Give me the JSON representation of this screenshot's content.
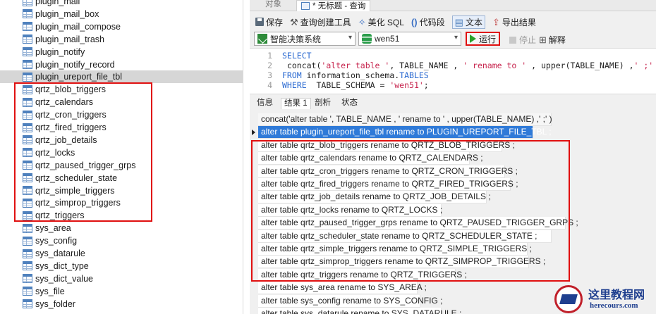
{
  "tree": {
    "items": [
      {
        "label": "plugin_mail"
      },
      {
        "label": "plugin_mail_box"
      },
      {
        "label": "plugin_mail_compose"
      },
      {
        "label": "plugin_mail_trash"
      },
      {
        "label": "plugin_notify"
      },
      {
        "label": "plugin_notify_record"
      },
      {
        "label": "plugin_ureport_file_tbl",
        "selected": true
      },
      {
        "label": "qrtz_blob_triggers"
      },
      {
        "label": "qrtz_calendars"
      },
      {
        "label": "qrtz_cron_triggers"
      },
      {
        "label": "qrtz_fired_triggers"
      },
      {
        "label": "qrtz_job_details"
      },
      {
        "label": "qrtz_locks"
      },
      {
        "label": "qrtz_paused_trigger_grps"
      },
      {
        "label": "qrtz_scheduler_state"
      },
      {
        "label": "qrtz_simple_triggers"
      },
      {
        "label": "qrtz_simprop_triggers"
      },
      {
        "label": "qrtz_triggers"
      },
      {
        "label": "sys_area"
      },
      {
        "label": "sys_config"
      },
      {
        "label": "sys_datarule"
      },
      {
        "label": "sys_dict_type"
      },
      {
        "label": "sys_dict_value"
      },
      {
        "label": "sys_file"
      },
      {
        "label": "sys_folder"
      }
    ]
  },
  "tabs": {
    "objects": "对象",
    "query": "* 无标题 - 查询"
  },
  "toolbar": {
    "save": "保存",
    "query_builder": "查询创建工具",
    "beautify": "美化 SQL",
    "snippet": "代码段",
    "text": "文本",
    "export": "导出结果"
  },
  "runbar": {
    "connection": "智能决策系统",
    "database": "wen51",
    "run": "运行",
    "stop": "停止",
    "explain": "解释"
  },
  "editor": {
    "lines": [
      {
        "num": "1",
        "parts": [
          {
            "t": "SELECT",
            "c": "kw"
          }
        ]
      },
      {
        "num": "2",
        "parts": [
          {
            "t": " concat(",
            "c": ""
          },
          {
            "t": "'alter table '",
            "c": "str"
          },
          {
            "t": ", TABLE_NAME , ",
            "c": ""
          },
          {
            "t": "' rename to '",
            "c": "str"
          },
          {
            "t": " , upper(TABLE_NAME) ,",
            "c": ""
          },
          {
            "t": "' ;'",
            "c": "str"
          },
          {
            "t": " )",
            "c": ""
          }
        ]
      },
      {
        "num": "3",
        "parts": [
          {
            "t": "FROM",
            "c": "kw"
          },
          {
            "t": " information_schema.",
            "c": ""
          },
          {
            "t": "TABLES",
            "c": "kw"
          }
        ]
      },
      {
        "num": "4",
        "parts": [
          {
            "t": "WHERE",
            "c": "kw"
          },
          {
            "t": "  TABLE_SCHEMA = ",
            "c": ""
          },
          {
            "t": "'wen51'",
            "c": "str"
          },
          {
            "t": ";",
            "c": ""
          }
        ]
      }
    ]
  },
  "result_tabs": {
    "info": "信息",
    "result1": "结果 1",
    "profile": "剖析",
    "status": "状态"
  },
  "grid": {
    "header": "concat('alter table ', TABLE_NAME , ' rename to ' , upper(TABLE_NAME) ,' ;' )",
    "rows": [
      {
        "text": "alter table plugin_ureport_file_tbl rename to PLUGIN_UREPORT_FILE_TBL ;",
        "selected": true
      },
      {
        "text": "alter table qrtz_blob_triggers rename to QRTZ_BLOB_TRIGGERS ;"
      },
      {
        "text": "alter table qrtz_calendars rename to QRTZ_CALENDARS ;"
      },
      {
        "text": "alter table qrtz_cron_triggers rename to QRTZ_CRON_TRIGGERS ;"
      },
      {
        "text": "alter table qrtz_fired_triggers rename to QRTZ_FIRED_TRIGGERS ;"
      },
      {
        "text": "alter table qrtz_job_details rename to QRTZ_JOB_DETAILS ;"
      },
      {
        "text": "alter table qrtz_locks rename to QRTZ_LOCKS ;"
      },
      {
        "text": "alter table qrtz_paused_trigger_grps rename to QRTZ_PAUSED_TRIGGER_GRPS ;"
      },
      {
        "text": "alter table qrtz_scheduler_state rename to QRTZ_SCHEDULER_STATE ;"
      },
      {
        "text": "alter table qrtz_simple_triggers rename to QRTZ_SIMPLE_TRIGGERS ;"
      },
      {
        "text": "alter table qrtz_simprop_triggers rename to QRTZ_SIMPROP_TRIGGERS ;"
      },
      {
        "text": "alter table qrtz_triggers rename to QRTZ_TRIGGERS ;"
      },
      {
        "text": "alter table sys_area rename to SYS_AREA ;"
      },
      {
        "text": "alter table sys_config rename to SYS_CONFIG ;"
      },
      {
        "text": "alter table sys_datarule rename to SYS_DATARULE ;"
      }
    ]
  },
  "watermark": {
    "name": "这里教程网",
    "url": "herecours.com"
  },
  "colors": {
    "highlight_box": "#e01010",
    "selection": "#2f7ad8",
    "keyword": "#2b6ad1",
    "string": "#c7254e"
  }
}
